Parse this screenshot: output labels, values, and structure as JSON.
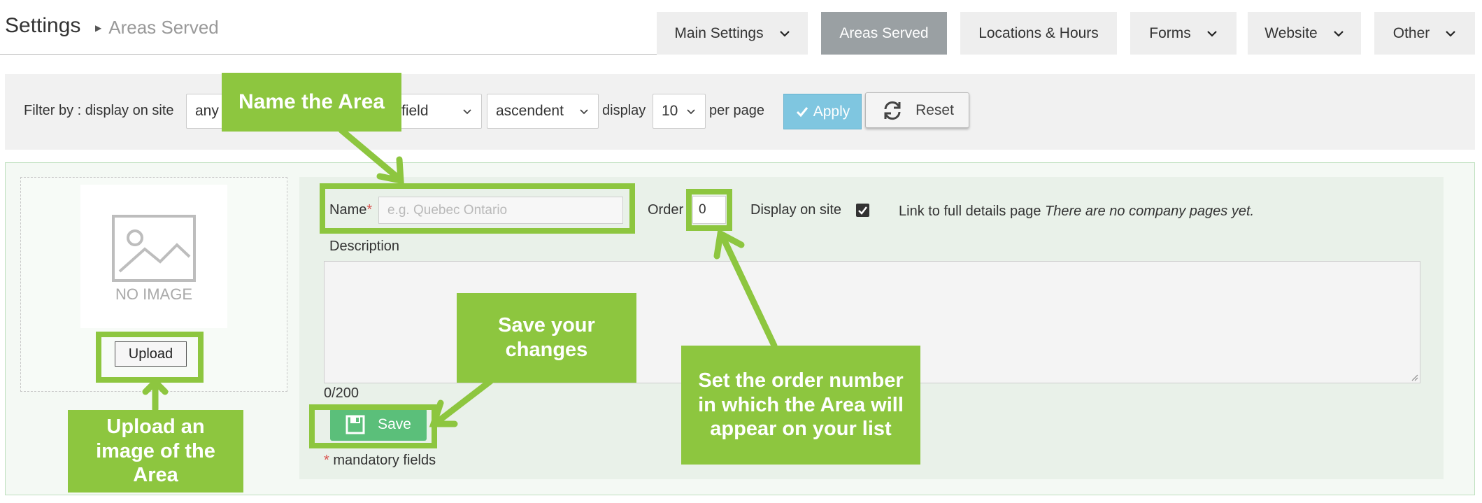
{
  "header": {
    "title": "Settings",
    "breadcrumb": "Areas Served"
  },
  "tabs": [
    {
      "label": "Main Settings",
      "has_dropdown": true
    },
    {
      "label": "Areas Served",
      "active": true
    },
    {
      "label": "Locations & Hours"
    },
    {
      "label": "Forms",
      "has_dropdown": true
    },
    {
      "label": "Website",
      "has_dropdown": true
    },
    {
      "label": "Other",
      "has_dropdown": true
    }
  ],
  "filter": {
    "prefix": "Filter by : display on site",
    "display_on_site_value": "any",
    "sort_field_value": "field",
    "order_value": "ascendent",
    "display_label": "display",
    "per_page_value": "10",
    "per_page_label": "per page",
    "apply_label": "Apply",
    "reset_label": "Reset"
  },
  "image": {
    "placeholder_text": "NO IMAGE",
    "upload_label": "Upload"
  },
  "form": {
    "name_label": "Name",
    "required_mark": "*",
    "name_placeholder": "e.g. Quebec Ontario",
    "order_label": "Order",
    "order_value": "0",
    "display_label": "Display on site",
    "display_checked": true,
    "link_label": "Link to full details page",
    "link_note": "There are no company pages yet.",
    "description_label": "Description",
    "char_count": "0/200",
    "save_label": "Save",
    "mandatory_note": "mandatory fields"
  },
  "callouts": {
    "name_area": "Name the Area",
    "save_changes": "Save your changes",
    "set_order": "Set the order number in which the Area will appear on your list",
    "upload_image": "Upload an image of the Area"
  },
  "colors": {
    "callout_green": "#8dc63f",
    "active_tab": "#9aa0a3",
    "apply_blue": "#7fc6e0",
    "save_green": "#5bbf7a"
  }
}
